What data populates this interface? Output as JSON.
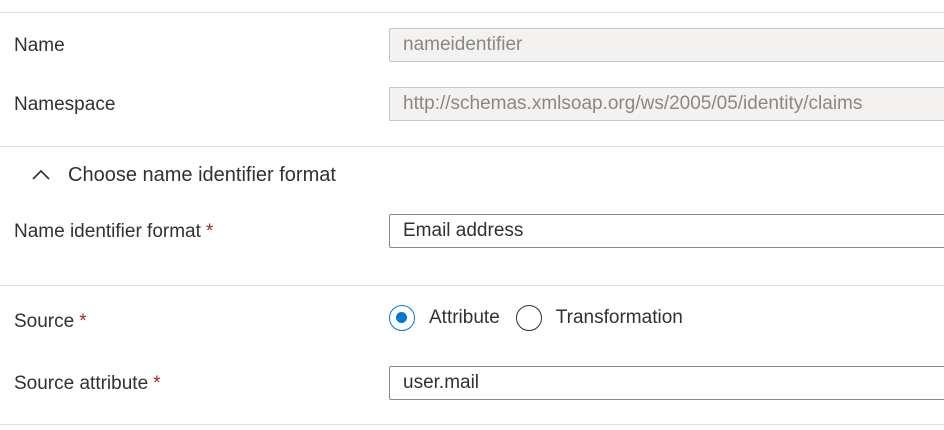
{
  "claim": {
    "name": {
      "label": "Name",
      "value": "nameidentifier"
    },
    "namespace": {
      "label": "Namespace",
      "value": "http://schemas.xmlsoap.org/ws/2005/05/identity/claims"
    }
  },
  "format_section": {
    "title": "Choose name identifier format",
    "expanded": true,
    "chevron_icon": "chevron-up-icon",
    "format_label": "Name identifier format",
    "format_value": "Email address"
  },
  "source": {
    "label": "Source",
    "options": [
      {
        "label": "Attribute",
        "checked": true
      },
      {
        "label": "Transformation",
        "checked": false
      }
    ],
    "attribute_label": "Source attribute",
    "attribute_value": "user.mail"
  },
  "required_marker": "*",
  "colors": {
    "accent": "#0078d4",
    "required": "#a4262c",
    "divider": "#e1dfdd",
    "disabled_bg": "#f3f2f1"
  }
}
